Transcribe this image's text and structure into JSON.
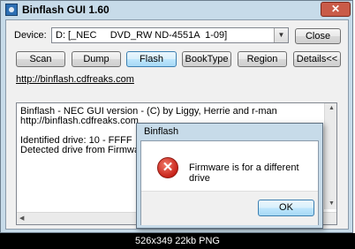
{
  "window": {
    "title": "Binflash GUI 1.60",
    "close_glyph": "✕"
  },
  "device": {
    "label": "Device:",
    "selected": "D: [_NEC     DVD_RW ND-4551A  1-09]",
    "close_label": "Close"
  },
  "toolbar": [
    {
      "label": "Scan"
    },
    {
      "label": "Dump"
    },
    {
      "label": "Flash"
    },
    {
      "label": "BookType"
    },
    {
      "label": "Region"
    },
    {
      "label": "Details<<"
    }
  ],
  "link": "http://binflash.cdfreaks.com",
  "log": [
    "Binflash - NEC GUI version - (C) by Liggy, Herrie and r-man",
    "http://binflash.cdfreaks.com",
    "",
    "Identified drive: 10 - FFFF",
    "Detected drive from Firmware: 13"
  ],
  "dialog": {
    "title": "Binflash",
    "icon": "error-icon",
    "message": "Firmware is for a different drive",
    "ok_label": "OK"
  },
  "caption": "526x349 22kb PNG",
  "colors": {
    "frame": "#c7dbe9",
    "error": "#c8231a",
    "client": "#f0f0f0"
  }
}
